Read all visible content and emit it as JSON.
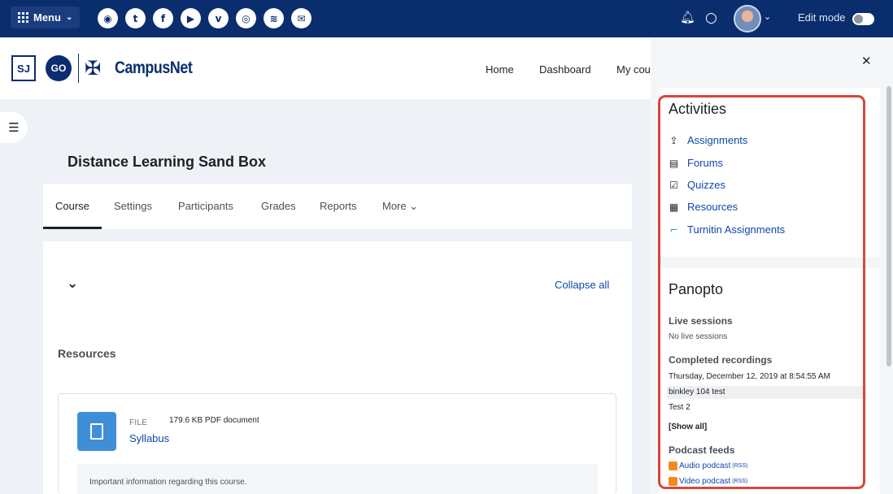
{
  "topbar": {
    "menu_label": "Menu",
    "menu_caret": "⌄",
    "social_icons": [
      "globe-icon",
      "twitter-icon",
      "facebook-icon",
      "youtube-icon",
      "vimeo-icon",
      "instagram-icon",
      "rss-icon",
      "email-icon"
    ],
    "social_glyphs": [
      "◉",
      "t",
      "f",
      "▶",
      "v",
      "◎",
      "≋",
      "✉"
    ],
    "bell_glyph": "🔔",
    "chat_glyph": "○",
    "edit_mode_label": "Edit mode",
    "edit_mode_on": false
  },
  "header": {
    "logo_sj": "SJ",
    "logo_go": "GO",
    "logo_text": "CampusNet",
    "nav": [
      "Home",
      "Dashboard",
      "My cou"
    ]
  },
  "course": {
    "title": "Distance Learning Sand Box",
    "tabs": [
      {
        "label": "Course",
        "active": true
      },
      {
        "label": "Settings",
        "active": false
      },
      {
        "label": "Participants",
        "active": false
      },
      {
        "label": "Grades",
        "active": false
      },
      {
        "label": "Reports",
        "active": false
      },
      {
        "label": "More ⌄",
        "active": false
      }
    ],
    "collapse_all": "Collapse all",
    "section_title": "Resources",
    "activity": {
      "type_label": "FILE",
      "meta": "179.6 KB PDF document",
      "name": "Syllabus",
      "description": "Important information regarding this course."
    }
  },
  "drawer": {
    "activities_title": "Activities",
    "activities": [
      {
        "label": "Assignments",
        "icon": "assignment-icon",
        "glyph": "⇪"
      },
      {
        "label": "Forums",
        "icon": "forum-icon",
        "glyph": "▤"
      },
      {
        "label": "Quizzes",
        "icon": "quiz-icon",
        "glyph": "☑"
      },
      {
        "label": "Resources",
        "icon": "resource-icon",
        "glyph": "▦"
      },
      {
        "label": "Turnitin Assignments",
        "icon": "turnitin-icon",
        "glyph": "⌐"
      }
    ],
    "panopto": {
      "title": "Panopto",
      "live_heading": "Live sessions",
      "live_text": "No live sessions",
      "completed_heading": "Completed recordings",
      "recordings": [
        "Thursday, December 12, 2019 at 8:54:55 AM",
        "binkley 104 test",
        "Test 2"
      ],
      "show_all": "[Show all]",
      "podcast_heading": "Podcast feeds",
      "podcasts": [
        {
          "label": "Audio podcast",
          "suffix": "(RSS)"
        },
        {
          "label": "Video podcast",
          "suffix": "(RSS)"
        }
      ]
    }
  },
  "colors": {
    "navbar": "#0a2d6e",
    "link": "#0f47ad",
    "highlight": "#d9463a"
  }
}
